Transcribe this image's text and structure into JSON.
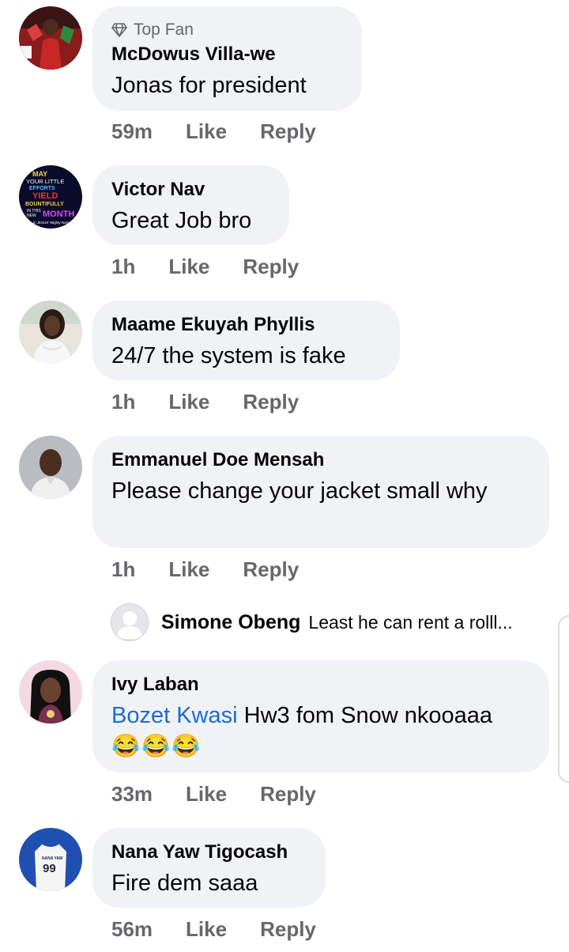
{
  "comments": [
    {
      "badge": "Top Fan",
      "author": "McDowus Villa-we",
      "text": "Jonas for president",
      "time": "59m",
      "like": "Like",
      "reply": "Reply"
    },
    {
      "author": "Victor Nav",
      "text": "Great Job bro",
      "time": "1h",
      "like": "Like",
      "reply": "Reply",
      "avatar_text": [
        "MAY",
        "YOUR LITTLE",
        "EFFORTS",
        "YIELD",
        "BOUNTIFULLY",
        "IN THIS",
        "NEW",
        "MONTH",
        "in JESUS' Mighty Name"
      ]
    },
    {
      "author": "Maame Ekuyah Phyllis",
      "text": "24/7 the system is fake",
      "time": "1h",
      "like": "Like",
      "reply": "Reply"
    },
    {
      "author": "Emmanuel Doe Mensah",
      "text": "Please change your jacket small why",
      "time": "1h",
      "like": "Like",
      "reply": "Reply",
      "reply_preview": {
        "author": "Simone Obeng",
        "text": "Least he can rent a rolll..."
      }
    },
    {
      "author": "Ivy Laban",
      "mention": "Bozet Kwasi",
      "text": " Hw3 fom Snow nkooaaa",
      "emojis": "😂😂😂",
      "time": "33m",
      "like": "Like",
      "reply": "Reply"
    },
    {
      "author": "Nana Yaw Tigocash",
      "text": "Fire dem saaa",
      "time": "56m",
      "like": "Like",
      "reply": "Reply",
      "avatar_text": [
        "NANA YAW",
        "99"
      ]
    }
  ],
  "colors": {
    "bubble": "#f0f2f5",
    "meta": "#65676b",
    "mention": "#1b6bd8"
  }
}
